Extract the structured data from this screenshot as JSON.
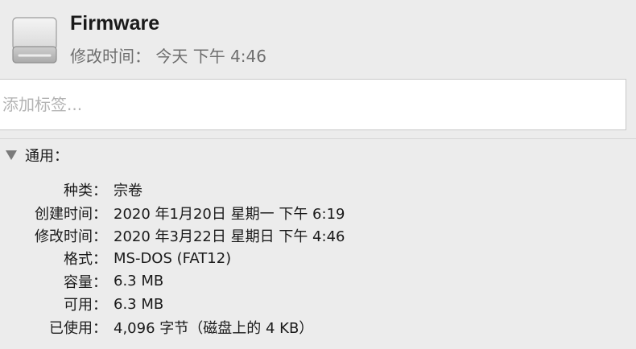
{
  "header": {
    "title": "Firmware",
    "subtitle": "修改时间： 今天 下午 4:46",
    "icon": "external-drive-icon"
  },
  "tags": {
    "placeholder": "添加标签...",
    "value": ""
  },
  "general": {
    "section_label": "通用：",
    "expanded": true,
    "rows": [
      {
        "label": "种类：",
        "value": "宗卷"
      },
      {
        "label": "创建时间：",
        "value": "2020 年1月20日 星期一 下午 6:19"
      },
      {
        "label": "修改时间：",
        "value": "2020 年3月22日 星期日 下午 4:46"
      },
      {
        "label": "格式：",
        "value": "MS-DOS (FAT12)"
      },
      {
        "label": "容量：",
        "value": "6.3 MB"
      },
      {
        "label": "可用：",
        "value": "6.3 MB"
      },
      {
        "label": "已使用：",
        "value": "4,096 字节（磁盘上的 4 KB）"
      }
    ]
  }
}
